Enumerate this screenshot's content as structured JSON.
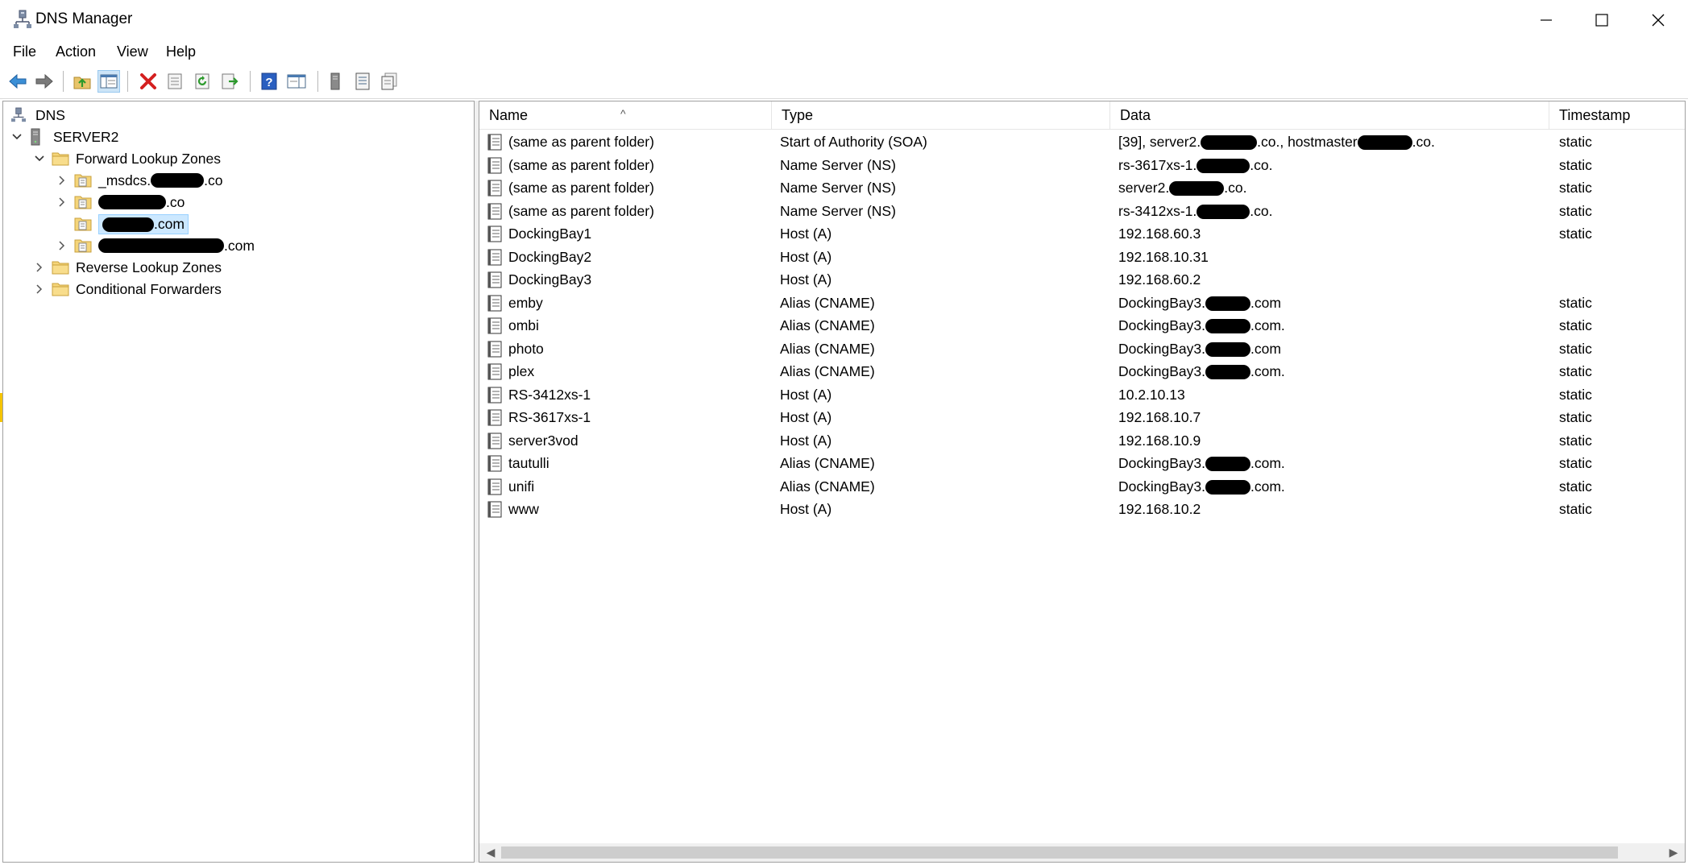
{
  "window": {
    "title": "DNS Manager"
  },
  "menu": [
    "File",
    "Action",
    "View",
    "Help"
  ],
  "tree": {
    "root": "DNS",
    "server": "SERVER2",
    "forward": "Forward Lookup Zones",
    "zones": [
      {
        "prefix": "_msdcs.",
        "suffix": ".co"
      },
      {
        "prefix": "",
        "suffix": ".co"
      },
      {
        "prefix": "",
        "suffix": ".com"
      },
      {
        "prefix": "",
        "suffix": ".com"
      }
    ],
    "reverse": "Reverse Lookup Zones",
    "conditional": "Conditional Forwarders"
  },
  "columns": [
    "Name",
    "Type",
    "Data",
    "Timestamp"
  ],
  "records": [
    {
      "name": "(same as parent folder)",
      "type": "Start of Authority (SOA)",
      "data_a": "[39], server2.",
      "data_b": ".co., hostmaster",
      "data_c": ".co.",
      "timestamp": "static"
    },
    {
      "name": "(same as parent folder)",
      "type": "Name Server (NS)",
      "data_a": "rs-3617xs-1.",
      "data_b": ".co.",
      "timestamp": "static"
    },
    {
      "name": "(same as parent folder)",
      "type": "Name Server (NS)",
      "data_a": "server2.",
      "data_b": ".co.",
      "timestamp": "static"
    },
    {
      "name": "(same as parent folder)",
      "type": "Name Server (NS)",
      "data_a": "rs-3412xs-1.",
      "data_b": ".co.",
      "timestamp": "static"
    },
    {
      "name": "DockingBay1",
      "type": "Host (A)",
      "data_a": "192.168.60.3",
      "timestamp": "static"
    },
    {
      "name": "DockingBay2",
      "type": "Host (A)",
      "data_a": "192.168.10.31",
      "timestamp": ""
    },
    {
      "name": "DockingBay3",
      "type": "Host (A)",
      "data_a": "192.168.60.2",
      "timestamp": ""
    },
    {
      "name": "emby",
      "type": "Alias (CNAME)",
      "data_a": "DockingBay3.",
      "data_b": ".com",
      "timestamp": "static"
    },
    {
      "name": "ombi",
      "type": "Alias (CNAME)",
      "data_a": "DockingBay3.",
      "data_b": ".com.",
      "timestamp": "static"
    },
    {
      "name": "photo",
      "type": "Alias (CNAME)",
      "data_a": "DockingBay3.",
      "data_b": ".com",
      "timestamp": "static"
    },
    {
      "name": "plex",
      "type": "Alias (CNAME)",
      "data_a": "DockingBay3.",
      "data_b": ".com.",
      "timestamp": "static"
    },
    {
      "name": "RS-3412xs-1",
      "type": "Host (A)",
      "data_a": "10.2.10.13",
      "timestamp": "static"
    },
    {
      "name": "RS-3617xs-1",
      "type": "Host (A)",
      "data_a": "192.168.10.7",
      "timestamp": "static"
    },
    {
      "name": "server3vod",
      "type": "Host (A)",
      "data_a": "192.168.10.9",
      "timestamp": "static"
    },
    {
      "name": "tautulli",
      "type": "Alias (CNAME)",
      "data_a": "DockingBay3.",
      "data_b": ".com.",
      "timestamp": "static"
    },
    {
      "name": "unifi",
      "type": "Alias (CNAME)",
      "data_a": "DockingBay3.",
      "data_b": ".com.",
      "timestamp": "static"
    },
    {
      "name": "www",
      "type": "Host (A)",
      "data_a": "192.168.10.2",
      "timestamp": "static"
    }
  ]
}
